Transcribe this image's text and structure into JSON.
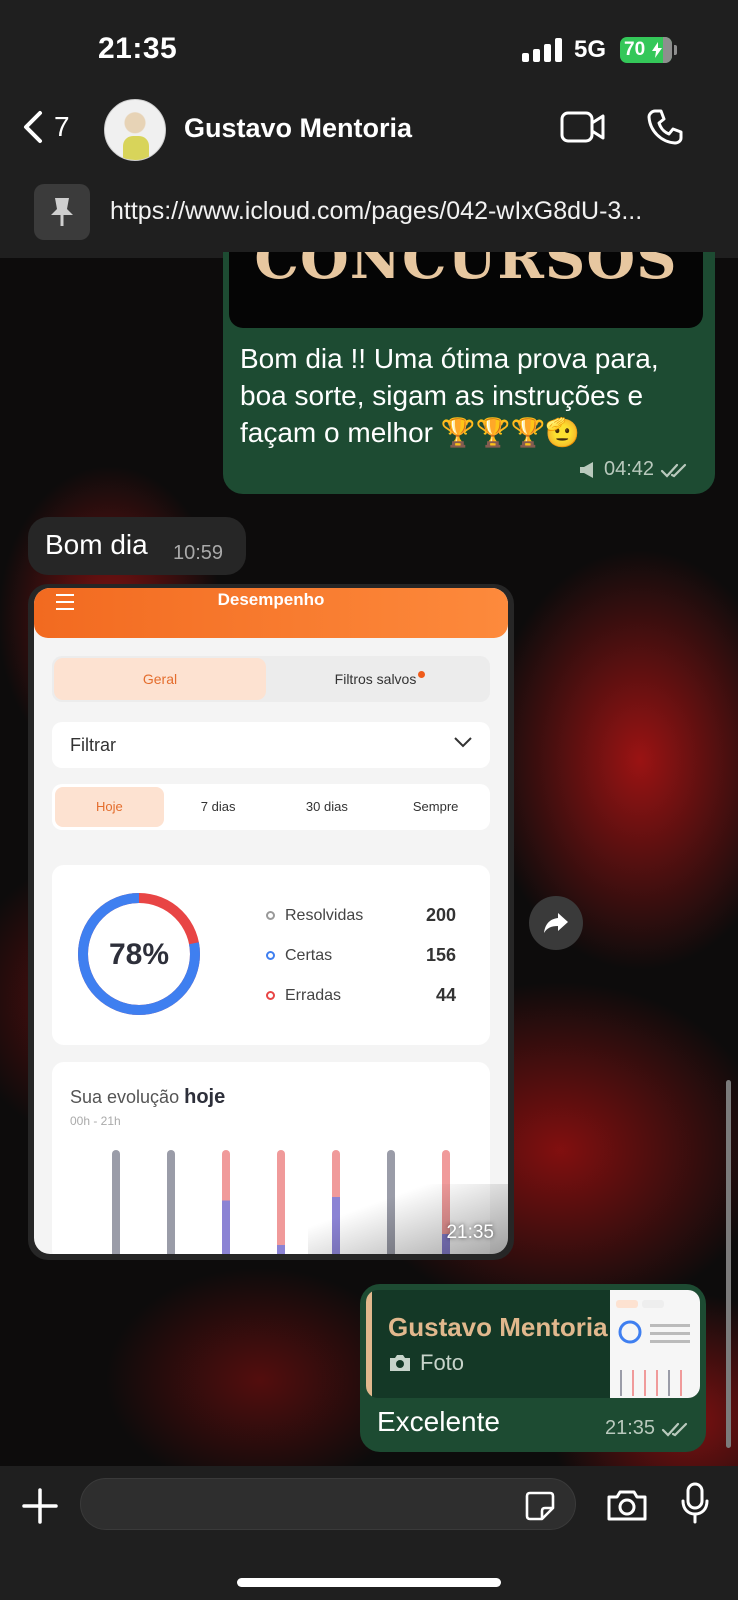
{
  "status_bar": {
    "time": "21:35",
    "network": "5G",
    "battery": "70"
  },
  "chat": {
    "back_count": "7",
    "contact_name": "Gustavo Mentoria",
    "pinned_text": "https://www.icloud.com/pages/042-wIxG8dU-3..."
  },
  "messages": {
    "m1": {
      "image_caption": "CONCURSOS",
      "text": "Bom dia !! Uma ótima prova para, boa sorte, sigam as instruções e façam o melhor 🏆🏆🏆🫡",
      "time": "04:42"
    },
    "m2": {
      "text": "Bom dia",
      "time": "10:59"
    },
    "m_photo": {
      "time": "21:35",
      "app": {
        "title": "Desempenho",
        "tab_active": "Geral",
        "tab_inactive": "Filtros salvos",
        "filter_label": "Filtrar",
        "ranges": [
          "Hoje",
          "7 dias",
          "30 dias",
          "Sempre"
        ],
        "percent": "78%",
        "percent_value": 78,
        "stats": [
          {
            "label": "Resolvidas",
            "value": "200"
          },
          {
            "label": "Certas",
            "value": "156"
          },
          {
            "label": "Erradas",
            "value": "44"
          }
        ],
        "evolution_prefix": "Sua evolução",
        "evolution_bold": "hoje",
        "evolution_range": "00h - 21h"
      }
    },
    "m3": {
      "quote_name": "Gustavo Mentoria",
      "quote_type": "Foto",
      "text": "Excelente",
      "time": "21:35"
    }
  },
  "colors": {
    "outgoing": "#1d4b32",
    "incoming": "#262626",
    "accent_orange": "#f26a20",
    "blue": "#3f7ff0",
    "red": "#e84545"
  }
}
